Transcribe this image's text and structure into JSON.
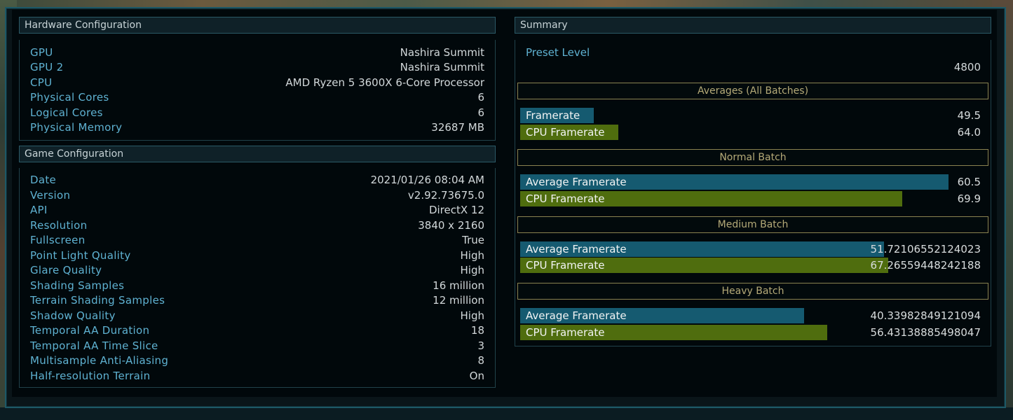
{
  "hardware": {
    "title": "Hardware Configuration",
    "rows": [
      {
        "key": "GPU",
        "value": "Nashira Summit"
      },
      {
        "key": "GPU 2",
        "value": "Nashira Summit"
      },
      {
        "key": "CPU",
        "value": "AMD Ryzen 5 3600X 6-Core Processor"
      },
      {
        "key": "Physical Cores",
        "value": "6"
      },
      {
        "key": "Logical Cores",
        "value": "6"
      },
      {
        "key": "Physical Memory",
        "value": "32687 MB"
      }
    ]
  },
  "game": {
    "title": "Game Configuration",
    "rows": [
      {
        "key": "Date",
        "value": "2021/01/26 08:04 AM"
      },
      {
        "key": "Version",
        "value": "v2.92.73675.0"
      },
      {
        "key": "API",
        "value": "DirectX 12"
      },
      {
        "key": "Resolution",
        "value": "3840 x 2160"
      },
      {
        "key": "Fullscreen",
        "value": "True"
      },
      {
        "key": "Point Light Quality",
        "value": "High"
      },
      {
        "key": "Glare Quality",
        "value": "High"
      },
      {
        "key": "Shading Samples",
        "value": "16 million"
      },
      {
        "key": "Terrain Shading Samples",
        "value": "12 million"
      },
      {
        "key": "Shadow Quality",
        "value": "High"
      },
      {
        "key": "Temporal AA Duration",
        "value": "18"
      },
      {
        "key": "Temporal AA Time Slice",
        "value": "3"
      },
      {
        "key": "Multisample Anti-Aliasing",
        "value": "8"
      },
      {
        "key": "Half-resolution Terrain",
        "value": "On"
      }
    ]
  },
  "summary": {
    "title": "Summary",
    "preset_label": "Preset Level",
    "preset_value": "4800",
    "groups": [
      {
        "title": "Averages (All Batches)",
        "bars": [
          {
            "label": "Framerate",
            "value": "49.5",
            "fill_fraction": 0.16,
            "color": "#155a70"
          },
          {
            "label": "CPU Framerate",
            "value": "64.0",
            "fill_fraction": 0.213,
            "color": "#4f6d0e"
          }
        ]
      },
      {
        "title": "Normal Batch",
        "bars": [
          {
            "label": "Average Framerate",
            "value": "60.5",
            "fill_fraction": 0.93,
            "color": "#155a70"
          },
          {
            "label": "CPU Framerate",
            "value": "69.9",
            "fill_fraction": 0.829,
            "color": "#4f6d0e"
          }
        ]
      },
      {
        "title": "Medium Batch",
        "bars": [
          {
            "label": "Average Framerate",
            "value": "51.72106552124023",
            "fill_fraction": 0.79,
            "color": "#155a70"
          },
          {
            "label": "CPU Framerate",
            "value": "67.26559448242188",
            "fill_fraction": 0.799,
            "color": "#4f6d0e"
          }
        ]
      },
      {
        "title": "Heavy Batch",
        "bars": [
          {
            "label": "Average Framerate",
            "value": "40.33982849121094",
            "fill_fraction": 0.616,
            "color": "#155a70"
          },
          {
            "label": "CPU Framerate",
            "value": "56.43138885498047",
            "fill_fraction": 0.667,
            "color": "#4f6d0e"
          }
        ]
      }
    ]
  }
}
